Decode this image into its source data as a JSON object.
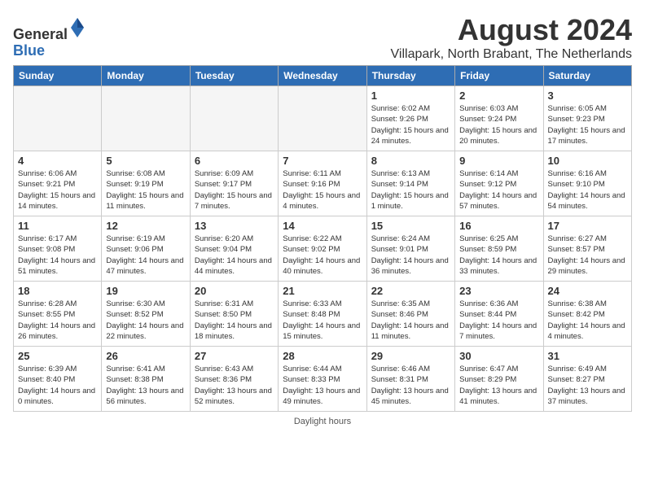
{
  "logo": {
    "general": "General",
    "blue": "Blue"
  },
  "title": "August 2024",
  "subtitle": "Villapark, North Brabant, The Netherlands",
  "days_of_week": [
    "Sunday",
    "Monday",
    "Tuesday",
    "Wednesday",
    "Thursday",
    "Friday",
    "Saturday"
  ],
  "footer": "Daylight hours",
  "weeks": [
    [
      {
        "day": "",
        "info": ""
      },
      {
        "day": "",
        "info": ""
      },
      {
        "day": "",
        "info": ""
      },
      {
        "day": "",
        "info": ""
      },
      {
        "day": "1",
        "info": "Sunrise: 6:02 AM\nSunset: 9:26 PM\nDaylight: 15 hours and 24 minutes."
      },
      {
        "day": "2",
        "info": "Sunrise: 6:03 AM\nSunset: 9:24 PM\nDaylight: 15 hours and 20 minutes."
      },
      {
        "day": "3",
        "info": "Sunrise: 6:05 AM\nSunset: 9:23 PM\nDaylight: 15 hours and 17 minutes."
      }
    ],
    [
      {
        "day": "4",
        "info": "Sunrise: 6:06 AM\nSunset: 9:21 PM\nDaylight: 15 hours and 14 minutes."
      },
      {
        "day": "5",
        "info": "Sunrise: 6:08 AM\nSunset: 9:19 PM\nDaylight: 15 hours and 11 minutes."
      },
      {
        "day": "6",
        "info": "Sunrise: 6:09 AM\nSunset: 9:17 PM\nDaylight: 15 hours and 7 minutes."
      },
      {
        "day": "7",
        "info": "Sunrise: 6:11 AM\nSunset: 9:16 PM\nDaylight: 15 hours and 4 minutes."
      },
      {
        "day": "8",
        "info": "Sunrise: 6:13 AM\nSunset: 9:14 PM\nDaylight: 15 hours and 1 minute."
      },
      {
        "day": "9",
        "info": "Sunrise: 6:14 AM\nSunset: 9:12 PM\nDaylight: 14 hours and 57 minutes."
      },
      {
        "day": "10",
        "info": "Sunrise: 6:16 AM\nSunset: 9:10 PM\nDaylight: 14 hours and 54 minutes."
      }
    ],
    [
      {
        "day": "11",
        "info": "Sunrise: 6:17 AM\nSunset: 9:08 PM\nDaylight: 14 hours and 51 minutes."
      },
      {
        "day": "12",
        "info": "Sunrise: 6:19 AM\nSunset: 9:06 PM\nDaylight: 14 hours and 47 minutes."
      },
      {
        "day": "13",
        "info": "Sunrise: 6:20 AM\nSunset: 9:04 PM\nDaylight: 14 hours and 44 minutes."
      },
      {
        "day": "14",
        "info": "Sunrise: 6:22 AM\nSunset: 9:02 PM\nDaylight: 14 hours and 40 minutes."
      },
      {
        "day": "15",
        "info": "Sunrise: 6:24 AM\nSunset: 9:01 PM\nDaylight: 14 hours and 36 minutes."
      },
      {
        "day": "16",
        "info": "Sunrise: 6:25 AM\nSunset: 8:59 PM\nDaylight: 14 hours and 33 minutes."
      },
      {
        "day": "17",
        "info": "Sunrise: 6:27 AM\nSunset: 8:57 PM\nDaylight: 14 hours and 29 minutes."
      }
    ],
    [
      {
        "day": "18",
        "info": "Sunrise: 6:28 AM\nSunset: 8:55 PM\nDaylight: 14 hours and 26 minutes."
      },
      {
        "day": "19",
        "info": "Sunrise: 6:30 AM\nSunset: 8:52 PM\nDaylight: 14 hours and 22 minutes."
      },
      {
        "day": "20",
        "info": "Sunrise: 6:31 AM\nSunset: 8:50 PM\nDaylight: 14 hours and 18 minutes."
      },
      {
        "day": "21",
        "info": "Sunrise: 6:33 AM\nSunset: 8:48 PM\nDaylight: 14 hours and 15 minutes."
      },
      {
        "day": "22",
        "info": "Sunrise: 6:35 AM\nSunset: 8:46 PM\nDaylight: 14 hours and 11 minutes."
      },
      {
        "day": "23",
        "info": "Sunrise: 6:36 AM\nSunset: 8:44 PM\nDaylight: 14 hours and 7 minutes."
      },
      {
        "day": "24",
        "info": "Sunrise: 6:38 AM\nSunset: 8:42 PM\nDaylight: 14 hours and 4 minutes."
      }
    ],
    [
      {
        "day": "25",
        "info": "Sunrise: 6:39 AM\nSunset: 8:40 PM\nDaylight: 14 hours and 0 minutes."
      },
      {
        "day": "26",
        "info": "Sunrise: 6:41 AM\nSunset: 8:38 PM\nDaylight: 13 hours and 56 minutes."
      },
      {
        "day": "27",
        "info": "Sunrise: 6:43 AM\nSunset: 8:36 PM\nDaylight: 13 hours and 52 minutes."
      },
      {
        "day": "28",
        "info": "Sunrise: 6:44 AM\nSunset: 8:33 PM\nDaylight: 13 hours and 49 minutes."
      },
      {
        "day": "29",
        "info": "Sunrise: 6:46 AM\nSunset: 8:31 PM\nDaylight: 13 hours and 45 minutes."
      },
      {
        "day": "30",
        "info": "Sunrise: 6:47 AM\nSunset: 8:29 PM\nDaylight: 13 hours and 41 minutes."
      },
      {
        "day": "31",
        "info": "Sunrise: 6:49 AM\nSunset: 8:27 PM\nDaylight: 13 hours and 37 minutes."
      }
    ]
  ]
}
